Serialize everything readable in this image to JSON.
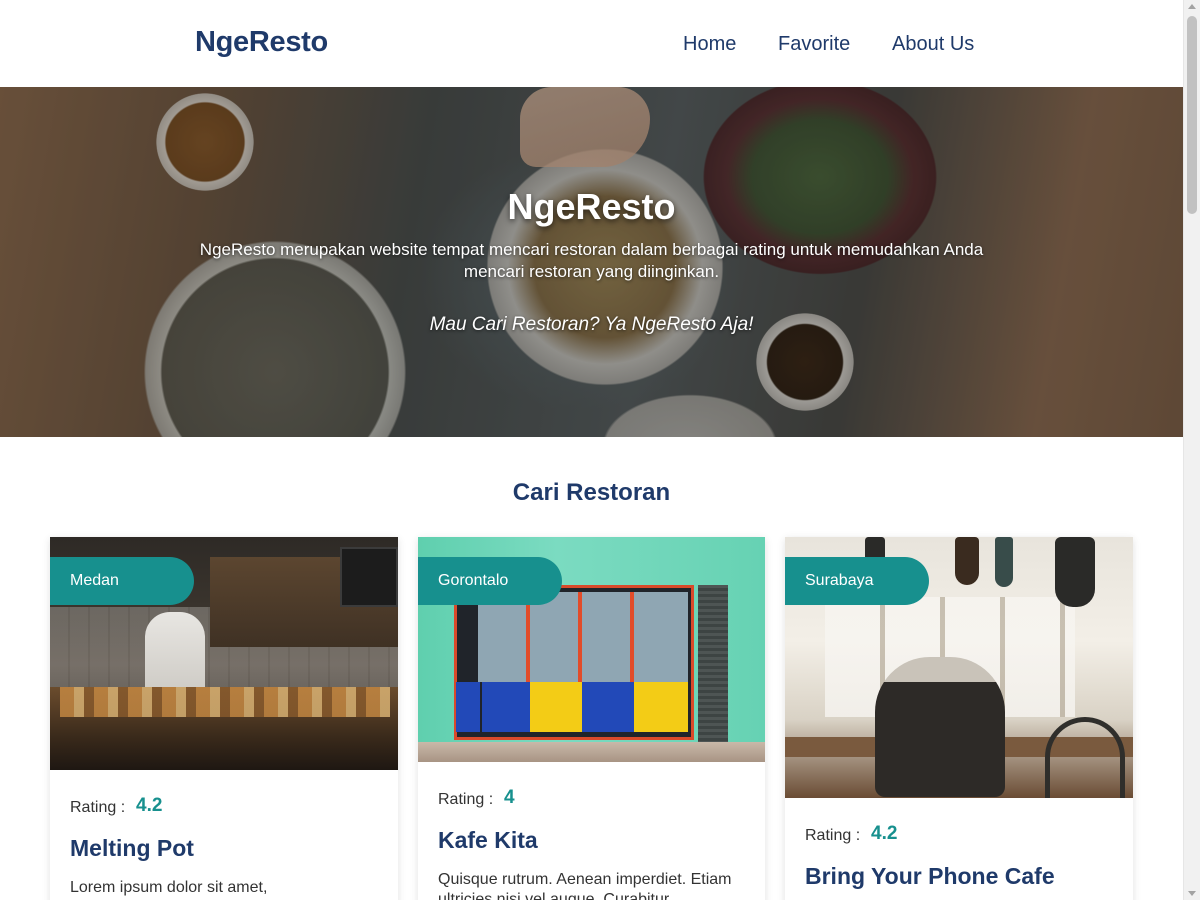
{
  "header": {
    "logo": "NgeResto",
    "nav": [
      "Home",
      "Favorite",
      "About Us"
    ]
  },
  "hero": {
    "title": "NgeResto",
    "description": "NgeResto merupakan website tempat mencari restoran dalam berbagai rating untuk memudahkan Anda mencari restoran yang diinginkan.",
    "tagline": "Mau Cari Restoran? Ya NgeResto Aja!"
  },
  "section": {
    "title": "Cari Restoran"
  },
  "rating_label": "Rating :",
  "restaurants": [
    {
      "city": "Medan",
      "rating": "4.2",
      "name": "Melting Pot",
      "description": "Lorem ipsum dolor sit amet,"
    },
    {
      "city": "Gorontalo",
      "rating": "4",
      "name": "Kafe Kita",
      "description": "Quisque rutrum. Aenean imperdiet. Etiam ultricies nisi vel augue. Curabitur"
    },
    {
      "city": "Surabaya",
      "rating": "4.2",
      "name": "Bring Your Phone Cafe",
      "description": ""
    }
  ],
  "colors": {
    "brand": "#1f3a6a",
    "accent": "#17908e"
  }
}
